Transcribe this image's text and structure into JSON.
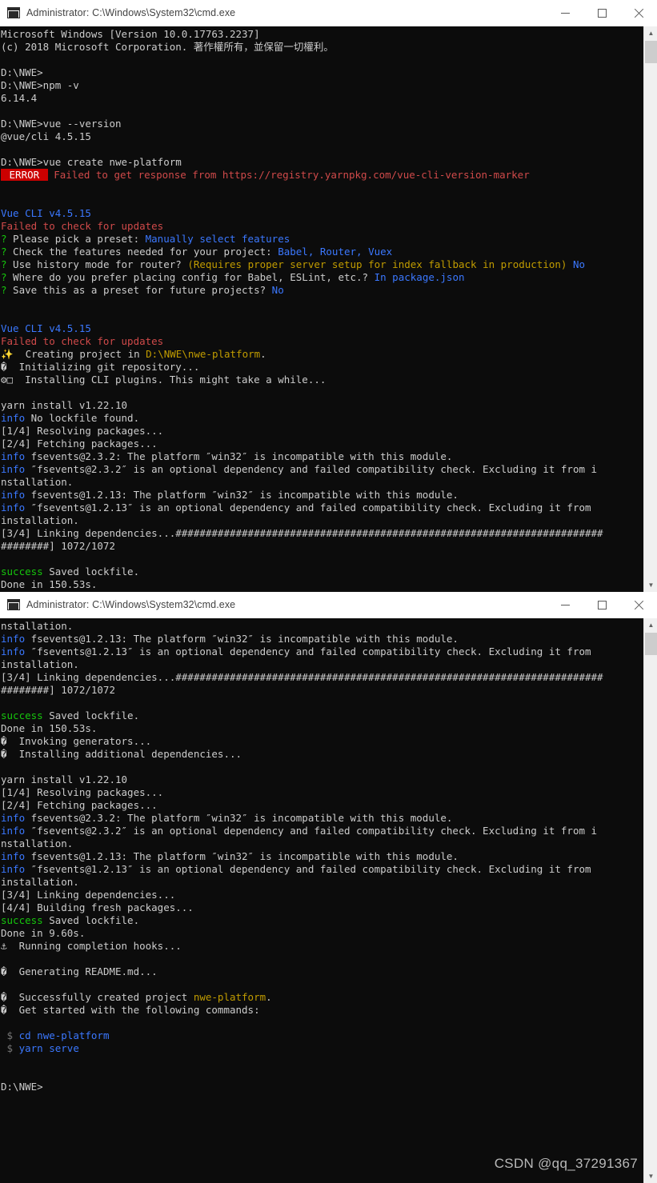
{
  "windows": [
    {
      "title": "Administrator: C:\\Windows\\System32\\cmd.exe",
      "controls": {
        "minimize": "–",
        "maximize": "□",
        "close": "✕"
      },
      "lines": [
        [
          {
            "t": "Microsoft Windows [Version 10.0.17763.2237]",
            "c": "c-white"
          }
        ],
        [
          {
            "t": "(c) 2018 Microsoft Corporation. 著作權所有，並保留一切權利。",
            "c": "c-white"
          }
        ],
        [],
        [
          {
            "t": "D:\\NWE>",
            "c": "c-white"
          }
        ],
        [
          {
            "t": "D:\\NWE>npm -v",
            "c": "c-white"
          }
        ],
        [
          {
            "t": "6.14.4",
            "c": "c-white"
          }
        ],
        [],
        [
          {
            "t": "D:\\NWE>vue --version",
            "c": "c-white"
          }
        ],
        [
          {
            "t": "@vue/cli 4.5.15",
            "c": "c-white"
          }
        ],
        [],
        [
          {
            "t": "D:\\NWE>vue create nwe-platform",
            "c": "c-white"
          }
        ],
        [
          {
            "t": " ERROR ",
            "c": "errbadge"
          },
          {
            "t": " Failed to get response from https://registry.yarnpkg.com/vue-cli-version-marker",
            "c": "c-red"
          }
        ],
        [],
        [],
        [
          {
            "t": "Vue CLI v4.5.15",
            "c": "c-blue"
          }
        ],
        [
          {
            "t": "Failed to check for updates",
            "c": "c-red"
          }
        ],
        [
          {
            "t": "?",
            "c": "c-green"
          },
          {
            "t": " Please pick a preset: ",
            "c": "c-white"
          },
          {
            "t": "Manually select features",
            "c": "c-blue"
          }
        ],
        [
          {
            "t": "?",
            "c": "c-green"
          },
          {
            "t": " Check the features needed for your project: ",
            "c": "c-white"
          },
          {
            "t": "Babel, Router, Vuex",
            "c": "c-blue"
          }
        ],
        [
          {
            "t": "?",
            "c": "c-green"
          },
          {
            "t": " Use history mode for router? ",
            "c": "c-white"
          },
          {
            "t": "(Requires proper server setup for index fallback in production)",
            "c": "c-yellow"
          },
          {
            "t": " ",
            "c": "c-white"
          },
          {
            "t": "No",
            "c": "c-blue"
          }
        ],
        [
          {
            "t": "?",
            "c": "c-green"
          },
          {
            "t": " Where do you prefer placing config for Babel, ESLint, etc.? ",
            "c": "c-white"
          },
          {
            "t": "In package.json",
            "c": "c-blue"
          }
        ],
        [
          {
            "t": "?",
            "c": "c-green"
          },
          {
            "t": " Save this as a preset for future projects? ",
            "c": "c-white"
          },
          {
            "t": "No",
            "c": "c-blue"
          }
        ],
        [],
        [],
        [
          {
            "t": "Vue CLI v4.5.15",
            "c": "c-blue"
          }
        ],
        [
          {
            "t": "Failed to check for updates",
            "c": "c-red"
          }
        ],
        [
          {
            "t": "✨",
            "c": "c-white"
          },
          {
            "t": "  Creating project in ",
            "c": "c-white"
          },
          {
            "t": "D:\\NWE\\nwe-platform",
            "c": "c-yellow"
          },
          {
            "t": ".",
            "c": "c-white"
          }
        ],
        [
          {
            "t": "�",
            "c": "c-white"
          },
          {
            "t": "  Initializing git repository...",
            "c": "c-white"
          }
        ],
        [
          {
            "t": "⚙□",
            "c": "c-white"
          },
          {
            "t": "  Installing CLI plugins. This might take a while...",
            "c": "c-white"
          }
        ],
        [],
        [
          {
            "t": "yarn install v1.22.10",
            "c": "c-white"
          }
        ],
        [
          {
            "t": "info",
            "c": "c-blue"
          },
          {
            "t": " No lockfile found.",
            "c": "c-white"
          }
        ],
        [
          {
            "t": "[1/4] Resolving packages...",
            "c": "c-white"
          }
        ],
        [
          {
            "t": "[2/4] Fetching packages...",
            "c": "c-white"
          }
        ],
        [
          {
            "t": "info",
            "c": "c-blue"
          },
          {
            "t": " fsevents@2.3.2: The platform ″win32″ is incompatible with this module.",
            "c": "c-white"
          }
        ],
        [
          {
            "t": "info",
            "c": "c-blue"
          },
          {
            "t": " ″fsevents@2.3.2″ is an optional dependency and failed compatibility check. Excluding it from i",
            "c": "c-white"
          }
        ],
        [
          {
            "t": "nstallation.",
            "c": "c-white"
          }
        ],
        [
          {
            "t": "info",
            "c": "c-blue"
          },
          {
            "t": " fsevents@1.2.13: The platform ″win32″ is incompatible with this module.",
            "c": "c-white"
          }
        ],
        [
          {
            "t": "info",
            "c": "c-blue"
          },
          {
            "t": " ″fsevents@1.2.13″ is an optional dependency and failed compatibility check. Excluding it from",
            "c": "c-white"
          }
        ],
        [
          {
            "t": "installation.",
            "c": "c-white"
          }
        ],
        [
          {
            "t": "[3/4] Linking dependencies...#######################################################################",
            "c": "c-white"
          }
        ],
        [
          {
            "t": "########] 1072/1072",
            "c": "c-white"
          }
        ],
        [],
        [
          {
            "t": "success",
            "c": "c-green"
          },
          {
            "t": " Saved lockfile.",
            "c": "c-white"
          }
        ],
        [
          {
            "t": "Done in 150.53s.",
            "c": "c-white"
          }
        ]
      ]
    },
    {
      "title": "Administrator: C:\\Windows\\System32\\cmd.exe",
      "controls": {
        "minimize": "–",
        "maximize": "□",
        "close": "✕"
      },
      "lines": [
        [
          {
            "t": "nstallation.",
            "c": "c-white"
          }
        ],
        [
          {
            "t": "info",
            "c": "c-blue"
          },
          {
            "t": " fsevents@1.2.13: The platform ″win32″ is incompatible with this module.",
            "c": "c-white"
          }
        ],
        [
          {
            "t": "info",
            "c": "c-blue"
          },
          {
            "t": " ″fsevents@1.2.13″ is an optional dependency and failed compatibility check. Excluding it from",
            "c": "c-white"
          }
        ],
        [
          {
            "t": "installation.",
            "c": "c-white"
          }
        ],
        [
          {
            "t": "[3/4] Linking dependencies...#######################################################################",
            "c": "c-white"
          }
        ],
        [
          {
            "t": "########] 1072/1072",
            "c": "c-white"
          }
        ],
        [],
        [
          {
            "t": "success",
            "c": "c-green"
          },
          {
            "t": " Saved lockfile.",
            "c": "c-white"
          }
        ],
        [
          {
            "t": "Done in 150.53s.",
            "c": "c-white"
          }
        ],
        [
          {
            "t": "�",
            "c": "c-white"
          },
          {
            "t": "  Invoking generators...",
            "c": "c-white"
          }
        ],
        [
          {
            "t": "�",
            "c": "c-white"
          },
          {
            "t": "  Installing additional dependencies...",
            "c": "c-white"
          }
        ],
        [],
        [
          {
            "t": "yarn install v1.22.10",
            "c": "c-white"
          }
        ],
        [
          {
            "t": "[1/4] Resolving packages...",
            "c": "c-white"
          }
        ],
        [
          {
            "t": "[2/4] Fetching packages...",
            "c": "c-white"
          }
        ],
        [
          {
            "t": "info",
            "c": "c-blue"
          },
          {
            "t": " fsevents@2.3.2: The platform ″win32″ is incompatible with this module.",
            "c": "c-white"
          }
        ],
        [
          {
            "t": "info",
            "c": "c-blue"
          },
          {
            "t": " ″fsevents@2.3.2″ is an optional dependency and failed compatibility check. Excluding it from i",
            "c": "c-white"
          }
        ],
        [
          {
            "t": "nstallation.",
            "c": "c-white"
          }
        ],
        [
          {
            "t": "info",
            "c": "c-blue"
          },
          {
            "t": " fsevents@1.2.13: The platform ″win32″ is incompatible with this module.",
            "c": "c-white"
          }
        ],
        [
          {
            "t": "info",
            "c": "c-blue"
          },
          {
            "t": " ″fsevents@1.2.13″ is an optional dependency and failed compatibility check. Excluding it from",
            "c": "c-white"
          }
        ],
        [
          {
            "t": "installation.",
            "c": "c-white"
          }
        ],
        [
          {
            "t": "[3/4] Linking dependencies...",
            "c": "c-white"
          }
        ],
        [
          {
            "t": "[4/4] Building fresh packages...",
            "c": "c-white"
          }
        ],
        [
          {
            "t": "success",
            "c": "c-green"
          },
          {
            "t": " Saved lockfile.",
            "c": "c-white"
          }
        ],
        [
          {
            "t": "Done in 9.60s.",
            "c": "c-white"
          }
        ],
        [
          {
            "t": "⚓",
            "c": "c-white"
          },
          {
            "t": "  Running completion hooks...",
            "c": "c-white"
          }
        ],
        [],
        [
          {
            "t": "�",
            "c": "c-white"
          },
          {
            "t": "  Generating README.md...",
            "c": "c-white"
          }
        ],
        [],
        [
          {
            "t": "�",
            "c": "c-white"
          },
          {
            "t": "  Successfully created project ",
            "c": "c-white"
          },
          {
            "t": "nwe-platform",
            "c": "c-yellow"
          },
          {
            "t": ".",
            "c": "c-white"
          }
        ],
        [
          {
            "t": "�",
            "c": "c-white"
          },
          {
            "t": "  Get started with the following commands:",
            "c": "c-white"
          }
        ],
        [],
        [
          {
            "t": " $",
            "c": "c-gray"
          },
          {
            "t": " ",
            "c": "c-white"
          },
          {
            "t": "cd nwe-platform",
            "c": "c-blue"
          }
        ],
        [
          {
            "t": " $",
            "c": "c-gray"
          },
          {
            "t": " ",
            "c": "c-white"
          },
          {
            "t": "yarn serve",
            "c": "c-blue"
          }
        ],
        [],
        [],
        [
          {
            "t": "D:\\NWE>",
            "c": "c-white"
          }
        ]
      ]
    }
  ],
  "watermark": "CSDN @qq_37291367",
  "colors": {
    "console_bg": "#0c0c0c",
    "console_fg": "#cccccc",
    "error_badge_bg": "#cc0000",
    "blue": "#3b78ff",
    "green": "#16c60c",
    "red": "#d04a4a",
    "yellow": "#c19c00",
    "titlebar_bg": "#ffffff",
    "scrollbar_track": "#f0f0f0",
    "scrollbar_thumb": "#cdcdcd"
  }
}
